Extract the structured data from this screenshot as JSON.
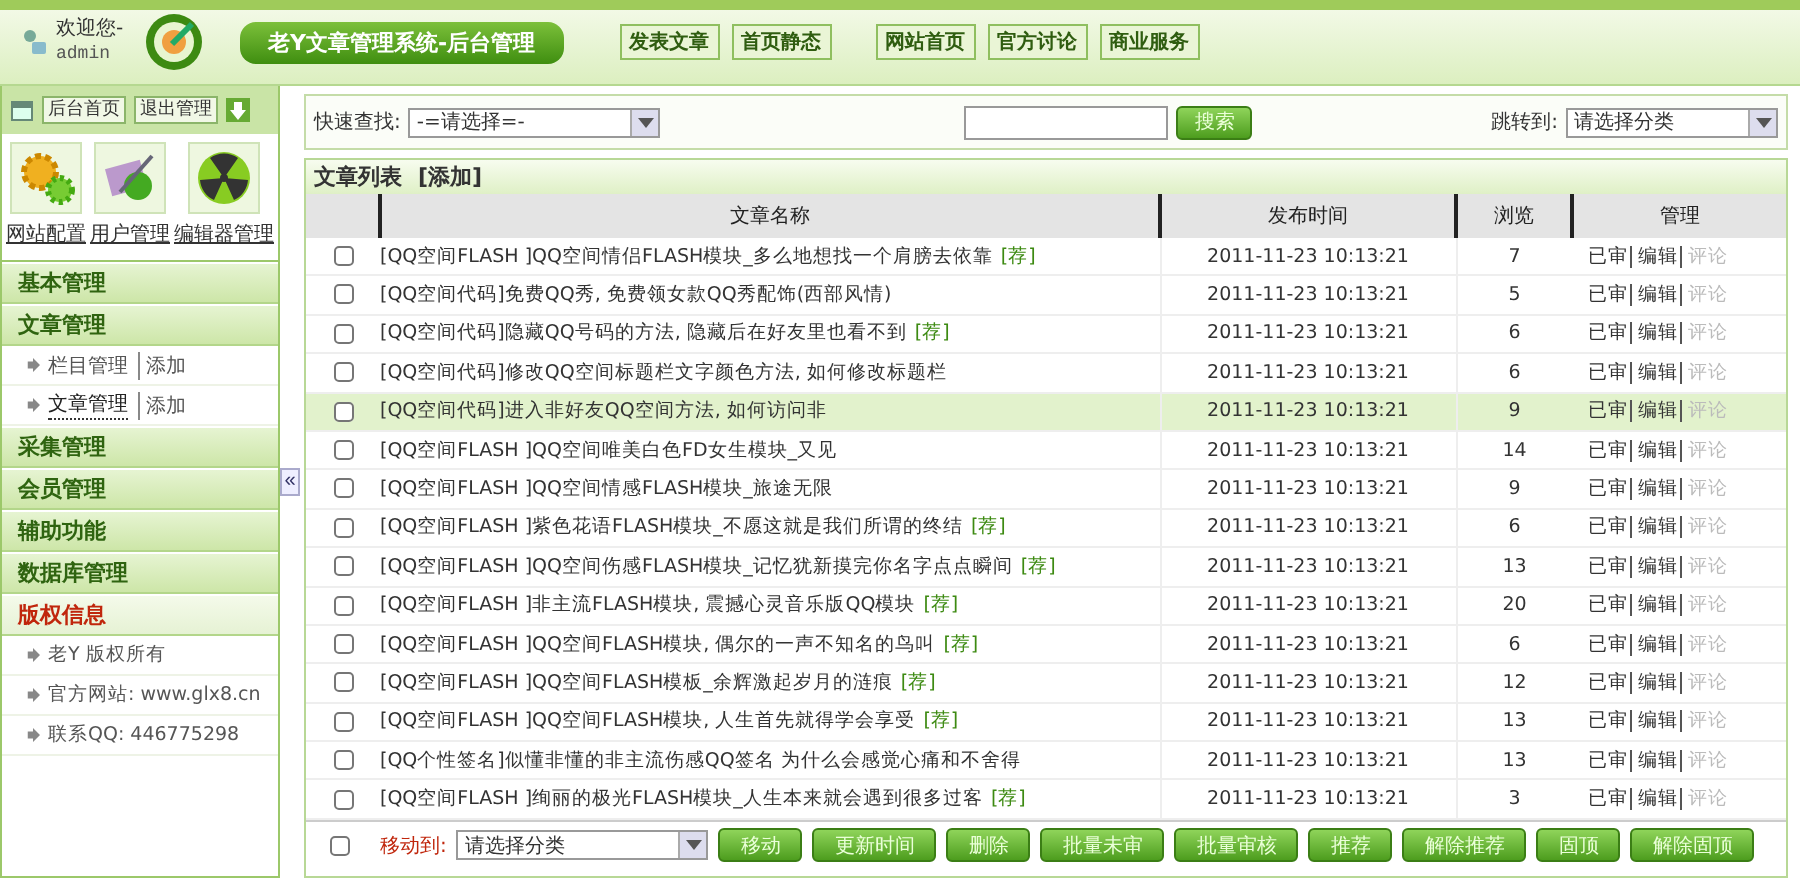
{
  "header": {
    "welcome": "欢迎您-",
    "user": "admin",
    "title": "老Y文章管理系统-后台管理",
    "nav_left": [
      "发表文章",
      "首页静态"
    ],
    "nav_right": [
      "网站首页",
      "官方讨论",
      "商业服务"
    ]
  },
  "sidebar": {
    "buttons": [
      "后台首页",
      "退出管理"
    ],
    "tools": [
      {
        "label": "网站配置",
        "kind": "gear"
      },
      {
        "label": "用户管理",
        "kind": "user"
      },
      {
        "label": "编辑器管理",
        "kind": "editor"
      }
    ],
    "sections": [
      {
        "title": "基本管理",
        "kind": "menu"
      },
      {
        "title": "文章管理",
        "kind": "menu",
        "items": [
          {
            "label": "栏目管理",
            "action": "添加",
            "selected": false
          },
          {
            "label": "文章管理",
            "action": "添加",
            "selected": true
          }
        ]
      },
      {
        "title": "采集管理",
        "kind": "menu"
      },
      {
        "title": "会员管理",
        "kind": "menu"
      },
      {
        "title": "辅助功能",
        "kind": "menu"
      },
      {
        "title": "数据库管理",
        "kind": "menu"
      },
      {
        "title": "版权信息",
        "kind": "info",
        "items": [
          {
            "label": "老Y 版权所有"
          },
          {
            "label": "官方网站: www.glx8.cn"
          },
          {
            "label": "联系QQ: 446775298"
          }
        ]
      }
    ],
    "collapse": "«"
  },
  "toolbar": {
    "quick_label": "快速查找:",
    "quick_select": "-=请选择=-",
    "search_button": "搜索",
    "jump_label": "跳转到:",
    "jump_select": "请选择分类"
  },
  "list": {
    "title": "文章列表",
    "add": "[添加]",
    "columns": [
      "文章名称",
      "发布时间",
      "浏览",
      "管理"
    ],
    "rows": [
      {
        "title": "[QQ空间FLASH ]QQ空间情侣FLASH模块_多么地想找一个肩膀去依靠",
        "tag": "[荐]",
        "time": "2011-11-23 10:13:21",
        "views": "7",
        "selected": false,
        "checked": false,
        "actions": [
          {
            "label": "已审",
            "disabled": false
          },
          {
            "label": "编辑",
            "disabled": false
          },
          {
            "label": "评论",
            "disabled": true
          }
        ]
      },
      {
        "title": "[QQ空间代码]免费QQ秀, 免费领女款QQ秀配饰(西部风情)",
        "time": "2011-11-23 10:13:21",
        "views": "5",
        "selected": false,
        "checked": false,
        "actions": [
          {
            "label": "已审",
            "disabled": false
          },
          {
            "label": "编辑",
            "disabled": false
          },
          {
            "label": "评论",
            "disabled": true
          }
        ]
      },
      {
        "title": "[QQ空间代码]隐藏QQ号码的方法, 隐藏后在好友里也看不到",
        "tag": "[荐]",
        "time": "2011-11-23 10:13:21",
        "views": "6",
        "selected": false,
        "checked": false,
        "actions": [
          {
            "label": "已审",
            "disabled": false
          },
          {
            "label": "编辑",
            "disabled": false
          },
          {
            "label": "评论",
            "disabled": true
          }
        ]
      },
      {
        "title": "[QQ空间代码]修改QQ空间标题栏文字颜色方法, 如何修改标题栏",
        "time": "2011-11-23 10:13:21",
        "views": "6",
        "selected": false,
        "checked": false,
        "actions": [
          {
            "label": "已审",
            "disabled": false
          },
          {
            "label": "编辑",
            "disabled": false
          },
          {
            "label": "评论",
            "disabled": true
          }
        ]
      },
      {
        "title": "[QQ空间代码]进入非好友QQ空间方法, 如何访问非",
        "time": "2011-11-23 10:13:21",
        "views": "9",
        "selected": true,
        "checked": false,
        "actions": [
          {
            "label": "已审",
            "disabled": false
          },
          {
            "label": "编辑",
            "disabled": false
          },
          {
            "label": "评论",
            "disabled": true
          }
        ]
      },
      {
        "title": "[QQ空间FLASH ]QQ空间唯美白色FD女生模块_又见",
        "time": "2011-11-23 10:13:21",
        "views": "14",
        "selected": false,
        "checked": false,
        "actions": [
          {
            "label": "已审",
            "disabled": false
          },
          {
            "label": "编辑",
            "disabled": false
          },
          {
            "label": "评论",
            "disabled": true
          }
        ]
      },
      {
        "title": "[QQ空间FLASH ]QQ空间情感FLASH模块_旅途无限",
        "time": "2011-11-23 10:13:21",
        "views": "9",
        "selected": false,
        "checked": false,
        "actions": [
          {
            "label": "已审",
            "disabled": false
          },
          {
            "label": "编辑",
            "disabled": false
          },
          {
            "label": "评论",
            "disabled": true
          }
        ]
      },
      {
        "title": "[QQ空间FLASH ]紫色花语FLASH模块_不愿这就是我们所谓的终结",
        "tag": "[荐]",
        "time": "2011-11-23 10:13:21",
        "views": "6",
        "selected": false,
        "checked": false,
        "actions": [
          {
            "label": "已审",
            "disabled": false
          },
          {
            "label": "编辑",
            "disabled": false
          },
          {
            "label": "评论",
            "disabled": true
          }
        ]
      },
      {
        "title": "[QQ空间FLASH ]QQ空间伤感FLASH模块_记忆犹新摸完你名字点点瞬间",
        "tag": "[荐]",
        "time": "2011-11-23 10:13:21",
        "views": "13",
        "selected": false,
        "checked": false,
        "actions": [
          {
            "label": "已审",
            "disabled": false
          },
          {
            "label": "编辑",
            "disabled": false
          },
          {
            "label": "评论",
            "disabled": true
          }
        ]
      },
      {
        "title": "[QQ空间FLASH ]非主流FLASH模块, 震撼心灵音乐版QQ模块",
        "tag": "[荐]",
        "time": "2011-11-23 10:13:21",
        "views": "20",
        "selected": false,
        "checked": false,
        "actions": [
          {
            "label": "已审",
            "disabled": false
          },
          {
            "label": "编辑",
            "disabled": false
          },
          {
            "label": "评论",
            "disabled": true
          }
        ]
      },
      {
        "title": "[QQ空间FLASH ]QQ空间FLASH模块, 偶尔的一声不知名的鸟叫",
        "tag": "[荐]",
        "time": "2011-11-23 10:13:21",
        "views": "6",
        "selected": false,
        "checked": false,
        "actions": [
          {
            "label": "已审",
            "disabled": false
          },
          {
            "label": "编辑",
            "disabled": false
          },
          {
            "label": "评论",
            "disabled": true
          }
        ]
      },
      {
        "title": "[QQ空间FLASH ]QQ空间FLASH模板_余辉激起岁月的涟痕",
        "tag": "[荐]",
        "time": "2011-11-23 10:13:21",
        "views": "12",
        "selected": false,
        "checked": false,
        "actions": [
          {
            "label": "已审",
            "disabled": false
          },
          {
            "label": "编辑",
            "disabled": false
          },
          {
            "label": "评论",
            "disabled": true
          }
        ]
      },
      {
        "title": "[QQ空间FLASH ]QQ空间FLASH模块, 人生首先就得学会享受",
        "tag": "[荐]",
        "time": "2011-11-23 10:13:21",
        "views": "13",
        "selected": false,
        "checked": false,
        "actions": [
          {
            "label": "已审",
            "disabled": false
          },
          {
            "label": "编辑",
            "disabled": false
          },
          {
            "label": "评论",
            "disabled": true
          }
        ]
      },
      {
        "title": "[QQ个性签名]似懂非懂的非主流伤感QQ签名 为什么会感觉心痛和不舍得",
        "time": "2011-11-23 10:13:21",
        "views": "13",
        "selected": false,
        "checked": false,
        "actions": [
          {
            "label": "已审",
            "disabled": false
          },
          {
            "label": "编辑",
            "disabled": false
          },
          {
            "label": "评论",
            "disabled": true
          }
        ]
      },
      {
        "title": "[QQ空间FLASH ]绚丽的极光FLASH模块_人生本来就会遇到很多过客",
        "tag": "[荐]",
        "time": "2011-11-23 10:13:21",
        "views": "3",
        "selected": false,
        "checked": false,
        "actions": [
          {
            "label": "已审",
            "disabled": false
          },
          {
            "label": "编辑",
            "disabled": false
          },
          {
            "label": "评论",
            "disabled": true
          }
        ]
      }
    ]
  },
  "bottom": {
    "checked": false,
    "move_label": "移动到:",
    "move_select": "请选择分类",
    "buttons": [
      "移动",
      "更新时间",
      "删除",
      "批量未审",
      "批量审核",
      "推荐",
      "解除推荐",
      "固顶",
      "解除固顶"
    ]
  }
}
